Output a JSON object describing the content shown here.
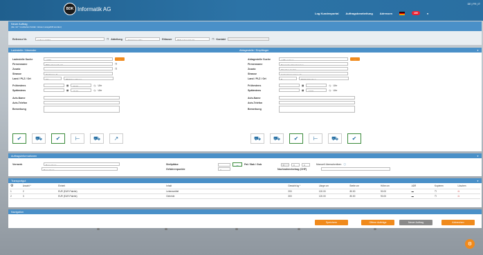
{
  "brand": {
    "logo": "BDK",
    "name": "Informatik AG"
  },
  "nav": {
    "log": "Log Kundenportal",
    "orders": "Auftragsbearbeitung",
    "address": "Adressen",
    "count": "100",
    "lang": "DE | FR | IT"
  },
  "neworder": {
    "title": "Neuer Auftrag",
    "subtitle": "(die mit * markierten Felder müssen ausgefüllt werden)",
    "ref_label": "Referenz Nr.",
    "ref_value": "Auftrag 12474",
    "dept_label": "Abteilung",
    "dept_value": "Abteil Assembly",
    "sender_label": "Erfasser",
    "sender_value": "BDK Informatik AG",
    "contact_label": "Kontakt"
  },
  "loading": {
    "title": "Ladestelle / Absender",
    "search_label": "Ladestelle Suche",
    "search_value": "n/a83",
    "firm_label": "Firmenname",
    "firm_value": "BDK Informatik AG",
    "extra_label": "Zusatz",
    "street_label": "Strasse",
    "street_value": "Dägitrasse 8",
    "land_label": "Land / PLZ / Ort",
    "country": "CH",
    "city": "8630 Kreuzlingen",
    "date_label": "Frühestens",
    "time1": "08:20",
    "latest_label": "Spätestens",
    "time2": "16:10",
    "uhr": "Uhr",
    "avis_label": "Avis-Name",
    "avis_tel": "Avis-Telefon",
    "note_label": "Bemerkung"
  },
  "unloading": {
    "title": "Ablagestelle / Empfänger",
    "search_label": "Ablagestelle Suche",
    "search_value": "mdBeyerlaum",
    "firm_label": "Firmenname",
    "firm_value": "Bayrischer Transfermtop",
    "extra_label": "Zusatz",
    "extra_value": "München GmbH",
    "street_label": "Strasse",
    "street_value": "Hoferstrasseunisee 11",
    "land_label": "Land / PLZ / Ort",
    "country": "B",
    "city": "80331 München",
    "date_label": "Frühestens",
    "latest_label": "Spätestens",
    "time2": "17:00",
    "uhr": "Uhr",
    "avis_label": "Avis-Name",
    "avis_tel": "Avis-Telefon",
    "note_label": "Bemerkung"
  },
  "info": {
    "title": "Auftragsinformationen",
    "remark_label": "Vermerk",
    "remark_ph": "Bemerkung",
    "remark_ph2": "Bemerkung",
    "places_label": "Stellplätze",
    "danger_label": "Gefahrenpunkte",
    "danger_value": "0",
    "pal_label": "Pal / Bak / Gob",
    "pal1": "0",
    "pal2": "0",
    "pal3": "0",
    "cod_label": "Nachnahmebetrag (CHF)",
    "manual": "Manuell überschreiben"
  },
  "transport": {
    "title": "Transportgut",
    "headers": [
      "Anzahl *",
      "Einheit",
      "Inhalt",
      "Gewicht kg *",
      "Länge cm",
      "Breite cm",
      "Höhe cm",
      "ADR",
      "Kopieren",
      "Löschen"
    ],
    "rows": [
      {
        "n": "1",
        "count": "2",
        "unit": "EUR (EUR-Palette)",
        "content": "Lebensmittel",
        "weight": "200",
        "len": "120.00",
        "wid": "80.00",
        "hei": "90.00"
      },
      {
        "n": "2",
        "count": "3",
        "unit": "EUR (EUR-Palette)",
        "content": "Getreide",
        "weight": "300",
        "len": "120.00",
        "wid": "80.00",
        "hei": "90.00"
      }
    ]
  },
  "navigation": {
    "title": "Navigation",
    "save": "Speichern",
    "open": "Offene Aufträge",
    "new": "Neuer Auftrag",
    "cancel": "Abbrechen"
  }
}
